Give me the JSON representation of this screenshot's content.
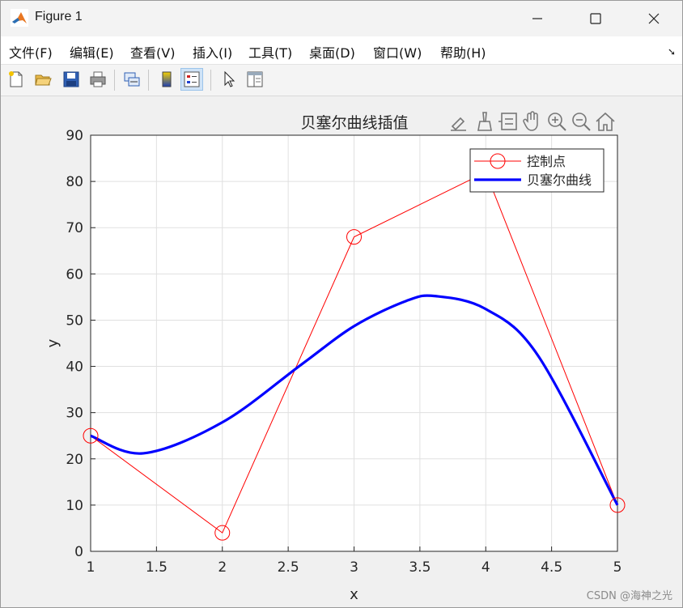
{
  "window": {
    "title": "Figure 1",
    "controls": {
      "minimize": "─",
      "maximize": "☐",
      "close": "✕"
    }
  },
  "menubar": {
    "items": [
      "文件(F)",
      "编辑(E)",
      "查看(V)",
      "插入(I)",
      "工具(T)",
      "桌面(D)",
      "窗口(W)",
      "帮助(H)"
    ],
    "dock_arrow": "➘"
  },
  "toolbar": {
    "buttons": [
      "new-figure",
      "open-file",
      "save",
      "print",
      "link-plot",
      "insert-colorbar",
      "insert-legend",
      "edit-plot",
      "property-inspector"
    ],
    "active": "insert-legend"
  },
  "axes_toolbar": {
    "buttons": [
      "export",
      "brush",
      "data-tips",
      "pan",
      "zoom-in",
      "zoom-out",
      "home"
    ]
  },
  "colors": {
    "control": "#ff0000",
    "curve": "#0000ff",
    "grid": "#e0e0e0"
  },
  "chart_data": {
    "type": "line",
    "title": "贝塞尔曲线插值",
    "xlabel": "x",
    "ylabel": "y",
    "xlim": [
      1,
      5
    ],
    "ylim": [
      0,
      90
    ],
    "xticks": [
      1,
      1.5,
      2,
      2.5,
      3,
      3.5,
      4,
      4.5,
      5
    ],
    "yticks": [
      0,
      10,
      20,
      30,
      40,
      50,
      60,
      70,
      80,
      90
    ],
    "grid": true,
    "legend_position": "top-right",
    "series": [
      {
        "name": "控制点",
        "style": "thin red line with circle markers",
        "x": [
          1,
          2,
          3,
          4,
          5
        ],
        "y": [
          25,
          4,
          68,
          82,
          10
        ]
      },
      {
        "name": "贝塞尔曲线",
        "style": "thick blue line",
        "x": [
          1,
          1.4,
          2,
          2.6,
          3,
          3.4,
          3.62,
          4,
          4.4,
          5
        ],
        "y": [
          25,
          21.2,
          27.9,
          40.4,
          48.7,
          54.2,
          55.2,
          52.4,
          42.2,
          10
        ]
      }
    ]
  },
  "watermark": "CSDN @海神之光"
}
